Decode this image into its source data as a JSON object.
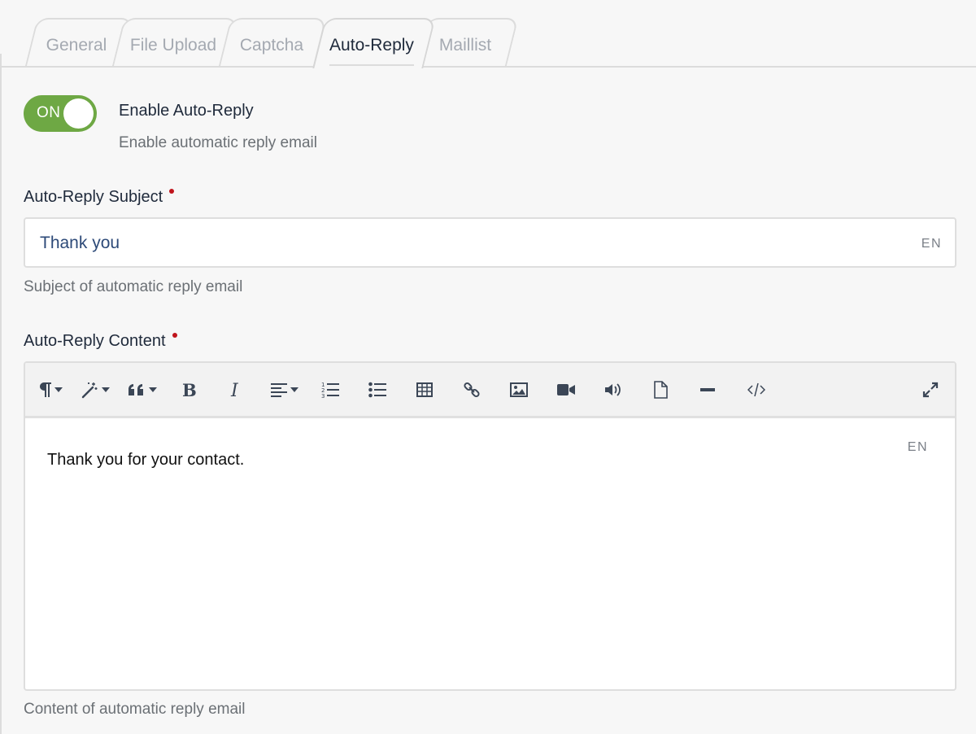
{
  "tabs": [
    {
      "label": "General"
    },
    {
      "label": "File Upload"
    },
    {
      "label": "Captcha"
    },
    {
      "label": "Auto-Reply",
      "active": true
    },
    {
      "label": "Maillist"
    }
  ],
  "enable": {
    "toggle_state": "ON",
    "title": "Enable Auto-Reply",
    "description": "Enable automatic reply email"
  },
  "subject": {
    "label": "Auto-Reply Subject",
    "value": "Thank you",
    "lang": "EN",
    "help": "Subject of automatic reply email"
  },
  "content": {
    "label": "Auto-Reply Content",
    "value": "Thank you for your contact.",
    "lang": "EN",
    "help": "Content of automatic reply email"
  },
  "toolbar_icons": [
    "paragraph-icon",
    "magic-wand-icon",
    "quote-icon",
    "bold-icon",
    "italic-icon",
    "align-icon",
    "ordered-list-icon",
    "unordered-list-icon",
    "table-icon",
    "link-icon",
    "image-icon",
    "video-icon",
    "audio-icon",
    "file-icon",
    "horizontal-rule-icon",
    "code-view-icon",
    "fullscreen-icon"
  ],
  "colors": {
    "toggle_on": "#6ea844",
    "required_dot": "#c0141c",
    "subject_text": "#2d4a78"
  }
}
